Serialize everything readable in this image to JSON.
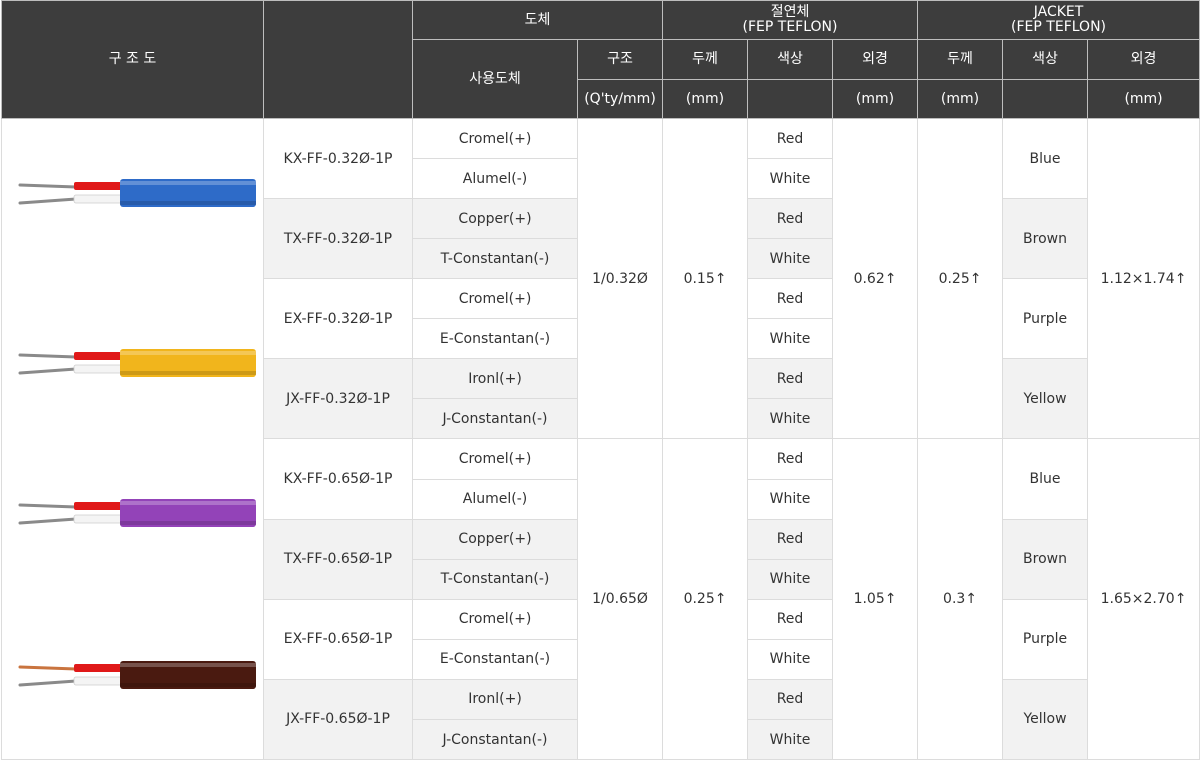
{
  "header": {
    "structure_diagram": "구 조 도",
    "conductor": "도체",
    "used_conductor": "사용도체",
    "structure": "구조",
    "structure_unit": "(Q'ty/mm)",
    "insulation": "절연체",
    "insulation_material": "(FEP TEFLON)",
    "jacket": "JACKET",
    "jacket_material": "(FEP TEFLON)",
    "thickness": "두께",
    "thickness_unit": "(mm)",
    "color": "색상",
    "outer_diameter": "외경",
    "outer_diameter_unit": "(mm)",
    "jacket_thickness": "두께",
    "jacket_thickness_unit": "(mm)",
    "jacket_color": "색상",
    "jacket_outer_diameter": "외경",
    "jacket_outer_diameter_unit": "(mm)"
  },
  "cable_images": [
    {
      "name": "blue-cable",
      "jacket_color": "#2e6bc8"
    },
    {
      "name": "yellow-cable",
      "jacket_color": "#f1b51c"
    },
    {
      "name": "purple-cable",
      "jacket_color": "#9343b8"
    },
    {
      "name": "brown-cable",
      "jacket_color": "#4a1a10"
    }
  ],
  "groups": [
    {
      "structure": "1/0.32Ø",
      "ins_thickness": "0.15↑",
      "ins_outer": "0.62↑",
      "jacket_thickness": "0.25↑",
      "jacket_outer": "1.12×1.74↑",
      "models": [
        {
          "model": "KX-FF-0.32Ø-1P",
          "jacket_color": "Blue",
          "conductors": [
            {
              "name": "Cromel(+)",
              "color": "Red"
            },
            {
              "name": "Alumel(-)",
              "color": "White"
            }
          ]
        },
        {
          "model": "TX-FF-0.32Ø-1P",
          "jacket_color": "Brown",
          "conductors": [
            {
              "name": "Copper(+)",
              "color": "Red"
            },
            {
              "name": "T-Constantan(-)",
              "color": "White"
            }
          ]
        },
        {
          "model": "EX-FF-0.32Ø-1P",
          "jacket_color": "Purple",
          "conductors": [
            {
              "name": "Cromel(+)",
              "color": "Red"
            },
            {
              "name": "E-Constantan(-)",
              "color": "White"
            }
          ]
        },
        {
          "model": "JX-FF-0.32Ø-1P",
          "jacket_color": "Yellow",
          "conductors": [
            {
              "name": "Ironl(+)",
              "color": "Red"
            },
            {
              "name": "J-Constantan(-)",
              "color": "White"
            }
          ]
        }
      ]
    },
    {
      "structure": "1/0.65Ø",
      "ins_thickness": "0.25↑",
      "ins_outer": "1.05↑",
      "jacket_thickness": "0.3↑",
      "jacket_outer": "1.65×2.70↑",
      "models": [
        {
          "model": "KX-FF-0.65Ø-1P",
          "jacket_color": "Blue",
          "conductors": [
            {
              "name": "Cromel(+)",
              "color": "Red"
            },
            {
              "name": "Alumel(-)",
              "color": "White"
            }
          ]
        },
        {
          "model": "TX-FF-0.65Ø-1P",
          "jacket_color": "Brown",
          "conductors": [
            {
              "name": "Copper(+)",
              "color": "Red"
            },
            {
              "name": "T-Constantan(-)",
              "color": "White"
            }
          ]
        },
        {
          "model": "EX-FF-0.65Ø-1P",
          "jacket_color": "Purple",
          "conductors": [
            {
              "name": "Cromel(+)",
              "color": "Red"
            },
            {
              "name": "E-Constantan(-)",
              "color": "White"
            }
          ]
        },
        {
          "model": "JX-FF-0.65Ø-1P",
          "jacket_color": "Yellow",
          "conductors": [
            {
              "name": "Ironl(+)",
              "color": "Red"
            },
            {
              "name": "J-Constantan(-)",
              "color": "White"
            }
          ]
        }
      ]
    }
  ]
}
